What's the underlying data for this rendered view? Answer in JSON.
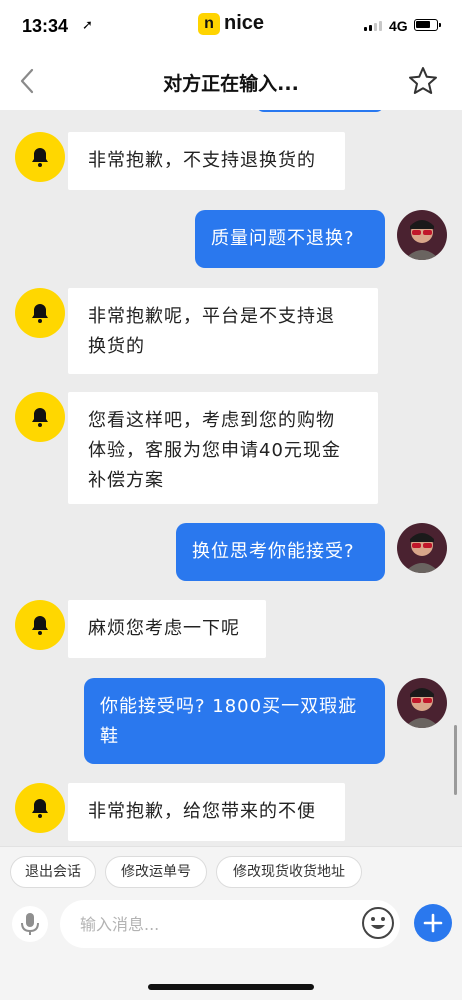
{
  "status_bar": {
    "time": "13:34",
    "location_icon": "location-arrow-icon",
    "brand_mark": "n",
    "brand_text": "nice",
    "network": "4G"
  },
  "nav": {
    "title": "对方正在输入...",
    "back_icon": "chevron-left-icon",
    "favorite_icon": "star-outline-icon"
  },
  "messages": [
    {
      "side": "in",
      "text": "非常抱歉，不支持退换货的"
    },
    {
      "side": "out",
      "text": "质量问题不退换?"
    },
    {
      "side": "in",
      "lines": [
        "非常抱歉呢，平台是不支持退",
        "换货的"
      ]
    },
    {
      "side": "in",
      "lines": [
        "您看这样吧，考虑到您的购物",
        "体验，客服为您申请40元现金",
        "补偿方案"
      ]
    },
    {
      "side": "out",
      "text": "换位思考你能接受?"
    },
    {
      "side": "in",
      "text": "麻烦您考虑一下呢"
    },
    {
      "side": "out",
      "lines": [
        "你能接受吗? 1800买一双瑕疵",
        "鞋"
      ]
    },
    {
      "side": "in",
      "text": "非常抱歉，给您带来的不便"
    }
  ],
  "quick_actions": [
    "退出会话",
    "修改运单号",
    "修改现货收货地址"
  ],
  "input": {
    "placeholder": "输入消息...",
    "value": ""
  },
  "colors": {
    "accent_blue": "#2a78ee",
    "bot_yellow": "#ffd700",
    "background": "#ececec"
  }
}
